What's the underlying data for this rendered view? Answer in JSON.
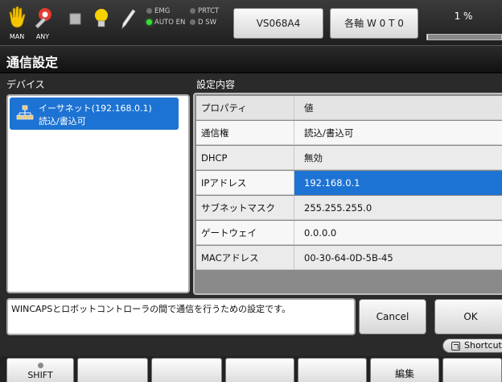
{
  "toolbar": {
    "icons": [
      {
        "name": "hand-icon",
        "label": "MAN"
      },
      {
        "name": "robot-arm-icon",
        "label": "ANY"
      },
      {
        "name": "stop-icon",
        "label": ""
      },
      {
        "name": "light-bulb-icon",
        "label": ""
      },
      {
        "name": "pen-icon",
        "label": ""
      }
    ],
    "leds": {
      "emg": {
        "label": "EMG",
        "on": false
      },
      "prtct": {
        "label": "PRTCT",
        "on": false
      },
      "auto_en": {
        "label": "AUTO EN",
        "on": true
      },
      "dsw": {
        "label": "D SW",
        "on": false
      }
    },
    "robot_button": "VS068A4",
    "axis_button": "各軸 W 0 T 0",
    "speed_label": "1 %",
    "speed_fraction": 0.01
  },
  "title": "通信設定",
  "device_header": "デバイス",
  "settings_header": "設定内容",
  "device": {
    "name": "イーサネット(192.168.0.1)",
    "access": "読込/書込可"
  },
  "settings": [
    {
      "property": "プロパティ",
      "value": "値"
    },
    {
      "property": "通信権",
      "value": "読込/書込可"
    },
    {
      "property": "DHCP",
      "value": "無効"
    },
    {
      "property": "IPアドレス",
      "value": "192.168.0.1"
    },
    {
      "property": "サブネットマスク",
      "value": "255.255.255.0"
    },
    {
      "property": "ゲートウェイ",
      "value": "0.0.0.0"
    },
    {
      "property": "MACアドレス",
      "value": "00-30-64-0D-5B-45"
    }
  ],
  "description": "WINCAPSとロボットコントローラの間で通信を行うための設定です。",
  "cancel_label": "Cancel",
  "ok_label": "OK",
  "shortcut_label": "Shortcut",
  "fkeys": [
    "SHIFT",
    "",
    "",
    "",
    "",
    "編集",
    ""
  ],
  "colors": {
    "selection": "#1d73d3",
    "led_on": "#35e035"
  }
}
